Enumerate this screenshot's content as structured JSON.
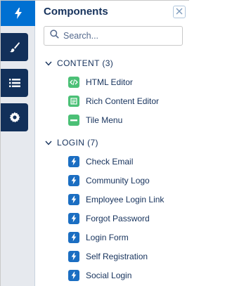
{
  "panel": {
    "title": "Components"
  },
  "search": {
    "placeholder": "Search..."
  },
  "sections": [
    {
      "label": "CONTENT (3)",
      "items": [
        {
          "label": "HTML Editor",
          "icon": "html-editor-icon"
        },
        {
          "label": "Rich Content Editor",
          "icon": "rich-content-icon"
        },
        {
          "label": "Tile Menu",
          "icon": "tile-menu-icon"
        }
      ]
    },
    {
      "label": "LOGIN (7)",
      "items": [
        {
          "label": "Check Email",
          "icon": "lightning-icon"
        },
        {
          "label": "Community Logo",
          "icon": "lightning-icon"
        },
        {
          "label": "Employee Login Link",
          "icon": "lightning-icon"
        },
        {
          "label": "Forgot Password",
          "icon": "lightning-icon"
        },
        {
          "label": "Login Form",
          "icon": "lightning-icon"
        },
        {
          "label": "Self Registration",
          "icon": "lightning-icon"
        },
        {
          "label": "Social Login",
          "icon": "lightning-icon"
        }
      ]
    }
  ],
  "colors": {
    "rail_active": "#0070d2",
    "rail_button": "#12305a",
    "content_icon": "#4bc076",
    "login_icon": "#1b6ec2",
    "text": "#16325c"
  }
}
